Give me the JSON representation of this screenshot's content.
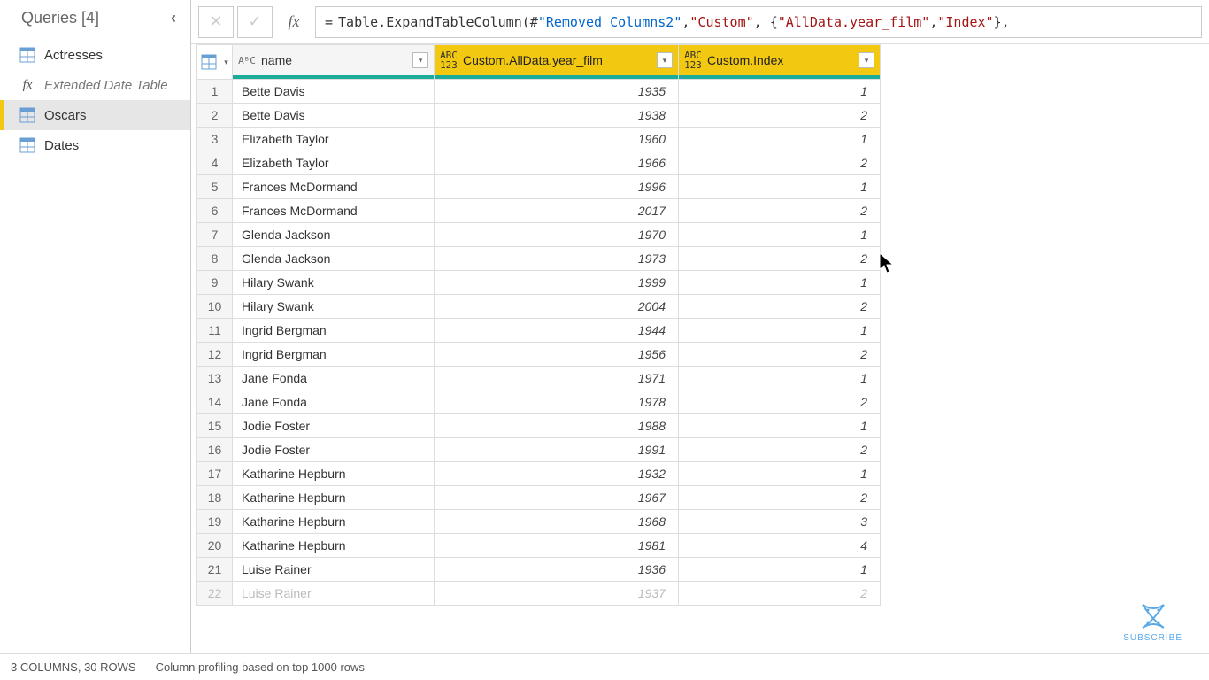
{
  "sidebar": {
    "title": "Queries [4]",
    "items": [
      {
        "label": "Actresses",
        "icon": "table"
      },
      {
        "label": "Extended Date Table",
        "icon": "fx"
      },
      {
        "label": "Oscars",
        "icon": "table"
      },
      {
        "label": "Dates",
        "icon": "table"
      }
    ]
  },
  "formula": {
    "eq": "=",
    "fn": "Table.ExpandTableColumn",
    "open": "(#",
    "a1": "\"Removed Columns2\"",
    "c1": ", ",
    "a2": "\"Custom\"",
    "c2": ", {",
    "a3": "\"AllData.year_film\"",
    "c3": ", ",
    "a4": "\"Index\"",
    "close": "},"
  },
  "columns": {
    "name_type": "AᴮC",
    "name_label": "name",
    "year_type": "ABC\n123",
    "year_label": "Custom.AllData.year_film",
    "idx_type": "ABC\n123",
    "idx_label": "Custom.Index"
  },
  "rows": [
    {
      "n": "1",
      "name": "Bette Davis",
      "year": "1935",
      "idx": "1"
    },
    {
      "n": "2",
      "name": "Bette Davis",
      "year": "1938",
      "idx": "2"
    },
    {
      "n": "3",
      "name": "Elizabeth Taylor",
      "year": "1960",
      "idx": "1"
    },
    {
      "n": "4",
      "name": "Elizabeth Taylor",
      "year": "1966",
      "idx": "2"
    },
    {
      "n": "5",
      "name": "Frances McDormand",
      "year": "1996",
      "idx": "1"
    },
    {
      "n": "6",
      "name": "Frances McDormand",
      "year": "2017",
      "idx": "2"
    },
    {
      "n": "7",
      "name": "Glenda Jackson",
      "year": "1970",
      "idx": "1"
    },
    {
      "n": "8",
      "name": "Glenda Jackson",
      "year": "1973",
      "idx": "2"
    },
    {
      "n": "9",
      "name": "Hilary Swank",
      "year": "1999",
      "idx": "1"
    },
    {
      "n": "10",
      "name": "Hilary Swank",
      "year": "2004",
      "idx": "2"
    },
    {
      "n": "11",
      "name": "Ingrid Bergman",
      "year": "1944",
      "idx": "1"
    },
    {
      "n": "12",
      "name": "Ingrid Bergman",
      "year": "1956",
      "idx": "2"
    },
    {
      "n": "13",
      "name": "Jane Fonda",
      "year": "1971",
      "idx": "1"
    },
    {
      "n": "14",
      "name": "Jane Fonda",
      "year": "1978",
      "idx": "2"
    },
    {
      "n": "15",
      "name": "Jodie Foster",
      "year": "1988",
      "idx": "1"
    },
    {
      "n": "16",
      "name": "Jodie Foster",
      "year": "1991",
      "idx": "2"
    },
    {
      "n": "17",
      "name": "Katharine Hepburn",
      "year": "1932",
      "idx": "1"
    },
    {
      "n": "18",
      "name": "Katharine Hepburn",
      "year": "1967",
      "idx": "2"
    },
    {
      "n": "19",
      "name": "Katharine Hepburn",
      "year": "1968",
      "idx": "3"
    },
    {
      "n": "20",
      "name": "Katharine Hepburn",
      "year": "1981",
      "idx": "4"
    },
    {
      "n": "21",
      "name": "Luise Rainer",
      "year": "1936",
      "idx": "1"
    },
    {
      "n": "22",
      "name": "Luise Rainer",
      "year": "1937",
      "idx": "2"
    }
  ],
  "statusbar": {
    "cols_rows": "3 COLUMNS, 30 ROWS",
    "profiling": "Column profiling based on top 1000 rows"
  },
  "subscribe": "SUBSCRIBE"
}
